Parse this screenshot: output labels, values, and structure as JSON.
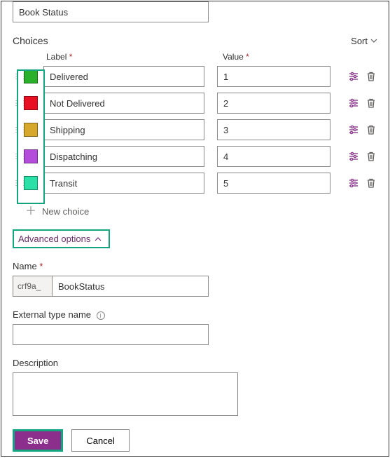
{
  "top_field_value": "Book Status",
  "choices_label": "Choices",
  "sort_label": "Sort",
  "columns": {
    "label": "Label",
    "value": "Value"
  },
  "choices": [
    {
      "color": "#2bb02b",
      "label": "Delivered",
      "value": "1"
    },
    {
      "color": "#e81123",
      "label": "Not Delivered",
      "value": "2"
    },
    {
      "color": "#d6a82b",
      "label": "Shipping",
      "value": "3"
    },
    {
      "color": "#b44ddb",
      "label": "Dispatching",
      "value": "4"
    },
    {
      "color": "#2be0a6",
      "label": "Transit",
      "value": "5"
    }
  ],
  "new_choice_label": "New choice",
  "advanced_label": "Advanced options",
  "name_section_label": "Name",
  "name_prefix": "crf9a_",
  "name_value": "BookStatus",
  "external_label": "External type name",
  "external_value": "",
  "description_label": "Description",
  "description_value": "",
  "buttons": {
    "save": "Save",
    "cancel": "Cancel"
  }
}
